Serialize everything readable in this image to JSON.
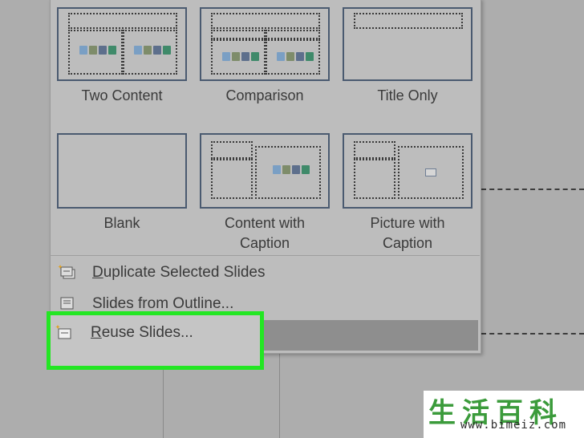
{
  "layouts_row1": [
    {
      "label": "Two Content"
    },
    {
      "label": "Comparison"
    },
    {
      "label": "Title Only"
    }
  ],
  "layouts_row2": [
    {
      "label": "Blank"
    },
    {
      "label": "Content with Caption"
    },
    {
      "label": "Picture with Caption"
    }
  ],
  "menu": {
    "duplicate": {
      "accel": "D",
      "rest": "uplicate Selected Slides"
    },
    "outline": {
      "label": "Slides from Outline..."
    },
    "reuse": {
      "accel": "R",
      "rest": "euse Slides..."
    }
  },
  "watermark": {
    "chars": "生活百科",
    "url": "www.bimeiz.com"
  },
  "colors": {
    "highlight_border": "#23e623",
    "thumb_border": "#4a5a70"
  }
}
